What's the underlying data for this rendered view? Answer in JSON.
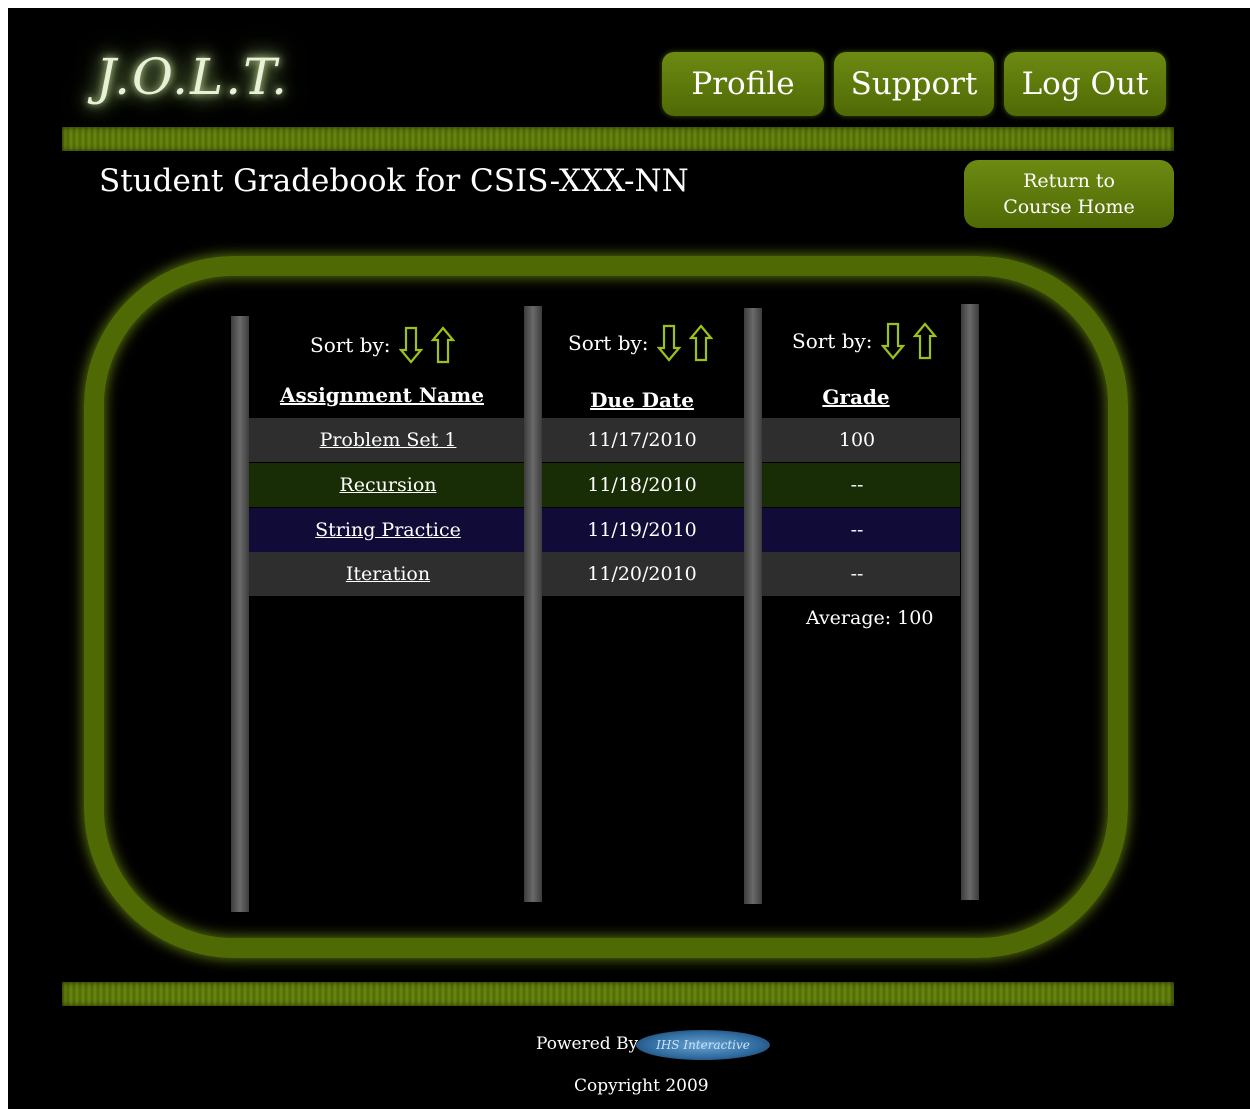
{
  "logo": "J.O.L.T.",
  "nav": {
    "profile": "Profile",
    "support": "Support",
    "logout": "Log Out"
  },
  "page_title": "Student Gradebook for CSIS-XXX-NN",
  "return_button": {
    "line1": "Return to",
    "line2": "Course Home"
  },
  "sort_label": "Sort by:",
  "columns": {
    "name": "Assignment Name",
    "due": "Due Date",
    "grade": "Grade"
  },
  "rows": [
    {
      "name": "Problem Set 1",
      "due": "11/17/2010",
      "grade": "100",
      "bg": "#2e2e2e"
    },
    {
      "name": "Recursion",
      "due": "11/18/2010",
      "grade": "--",
      "bg": "#182d05"
    },
    {
      "name": "String Practice",
      "due": "11/19/2010",
      "grade": "--",
      "bg": "#110b38"
    },
    {
      "name": "Iteration",
      "due": "11/20/2010",
      "grade": "--",
      "bg": "#2e2e2e"
    }
  ],
  "average": "Average: 100",
  "footer": {
    "powered": "Powered By",
    "logo_text": "IHS Interactive",
    "copyright": "Copyright 2009"
  },
  "colors": {
    "accent": "#5a7a0a",
    "background": "#000000"
  }
}
